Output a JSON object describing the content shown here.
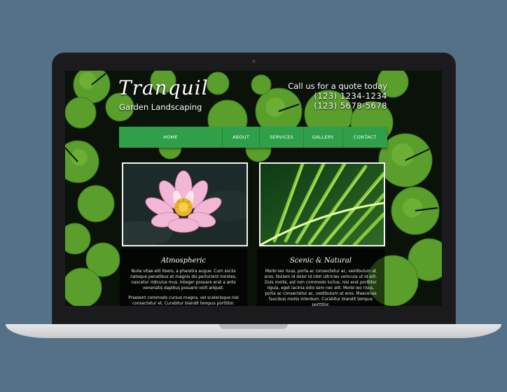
{
  "site": {
    "brand_title": "Tranquil",
    "brand_subtitle": "Garden Landscaping",
    "contact_cta": "Call us for a quote today",
    "phone_1": "(123) 1234-1234",
    "phone_2": "(123) 5678-5678"
  },
  "nav": {
    "items": [
      {
        "label": "HOME"
      },
      {
        "label": "ABOUT"
      },
      {
        "label": "SERVICES"
      },
      {
        "label": "GALLERY"
      },
      {
        "label": "CONTACT"
      }
    ]
  },
  "cards": [
    {
      "title": "Atmospheric",
      "p1": "Nulla vitae elit libero, a pharetra augue. Cum sociis natoque penatibus et magnis dis parturient montes, nascetur ridiculus mus. Integer posuere erat a ante venenatis dapibus posuere velit aliquet.",
      "p2": "Praesent commodo cursus magna, vel scelerisque nisl consectetur et. Curabitur blandit tempus porttitor."
    },
    {
      "title": "Scenic & Natural",
      "p1": "Morbi leo risus, porta ac consectetur ac, vestibulum at eros. Nullam id dolor id nibh ultricies vehicula ut id elit. Duis mollis, est non commodo luctus, nisi erat porttitor ligula, eget lacinia odio sem nec elit. Morbi leo risus, porta ac consectetur ac, vestibulum at eros. Maecenas faucibus mollis interdum. Curabitur blandit tempus porttitor.",
      "p2": ""
    }
  ],
  "colors": {
    "background": "#557188",
    "nav_green": "#2f9f4a",
    "pad_green": "#5fa82e"
  }
}
